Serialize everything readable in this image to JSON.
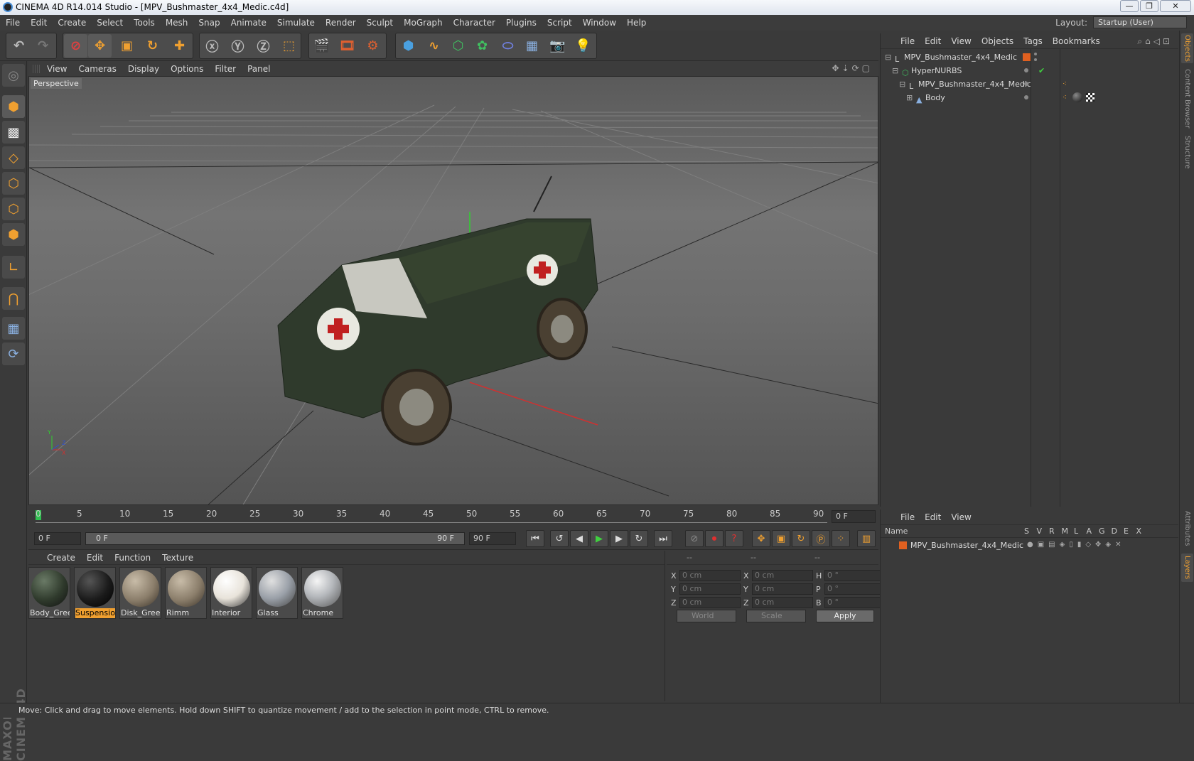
{
  "window": {
    "title": "CINEMA 4D R14.014 Studio - [MPV_Bushmaster_4x4_Medic.c4d]",
    "buttons": {
      "minimize": "—",
      "maximize": "❐",
      "close": "✕"
    }
  },
  "menubar": {
    "items": [
      "File",
      "Edit",
      "Create",
      "Select",
      "Tools",
      "Mesh",
      "Snap",
      "Animate",
      "Simulate",
      "Render",
      "Sculpt",
      "MoGraph",
      "Character",
      "Plugins",
      "Script",
      "Window",
      "Help"
    ],
    "layout_label": "Layout:",
    "layout_value": "Startup (User)"
  },
  "viewport": {
    "menu": [
      "View",
      "Cameras",
      "Display",
      "Options",
      "Filter",
      "Panel"
    ],
    "label": "Perspective",
    "axis_labels": {
      "y": "Y",
      "z": "Z",
      "x": "X"
    }
  },
  "timeline": {
    "ticks": [
      "0",
      "5",
      "10",
      "15",
      "20",
      "25",
      "30",
      "35",
      "40",
      "45",
      "50",
      "55",
      "60",
      "65",
      "70",
      "75",
      "80",
      "85",
      "90"
    ],
    "end_field": "0 F"
  },
  "transport": {
    "current_frame": "0 F",
    "range_start": "0 F",
    "range_end_inner": "90 F",
    "range_end": "90 F"
  },
  "materials": {
    "menu": [
      "Create",
      "Edit",
      "Function",
      "Texture"
    ],
    "items": [
      {
        "name": "Body_Gree",
        "selected": false,
        "color": "#2f3a2c"
      },
      {
        "name": "Suspension",
        "selected": true,
        "color": "#1a1a1a"
      },
      {
        "name": "Disk_Greer",
        "selected": false,
        "color": "#8a7d6a"
      },
      {
        "name": "Rimm",
        "selected": false,
        "color": "#8a7d6a"
      },
      {
        "name": "Interior",
        "selected": false,
        "color": "#e8e3da"
      },
      {
        "name": "Glass",
        "selected": false,
        "color": "#9aa0a8"
      },
      {
        "name": "Chrome",
        "selected": false,
        "color": "#b5b8bc"
      }
    ]
  },
  "coordinates": {
    "headers": [
      "--",
      "--",
      "--"
    ],
    "rows": [
      {
        "a": "X",
        "av": "0 cm",
        "b": "X",
        "bv": "0 cm",
        "c": "H",
        "cv": "0 °"
      },
      {
        "a": "Y",
        "av": "0 cm",
        "b": "Y",
        "bv": "0 cm",
        "c": "P",
        "cv": "0 °"
      },
      {
        "a": "Z",
        "av": "0 cm",
        "b": "Z",
        "bv": "0 cm",
        "c": "B",
        "cv": "0 °"
      }
    ],
    "mode1": "World",
    "mode2": "Scale",
    "apply": "Apply"
  },
  "objects": {
    "menu": [
      "File",
      "Edit",
      "View",
      "Objects",
      "Tags",
      "Bookmarks"
    ],
    "tree": [
      {
        "name": "MPV_Bushmaster_4x4_Medic",
        "type": "null"
      },
      {
        "name": "HyperNURBS",
        "type": "hypernurbs"
      },
      {
        "name": "MPV_Bushmaster_4x4_Medic",
        "type": "null"
      },
      {
        "name": "Body",
        "type": "polygon"
      }
    ]
  },
  "side_tabs": [
    "Objects",
    "Content Browser",
    "Structure",
    "Attributes",
    "Layers"
  ],
  "layers": {
    "menu": [
      "File",
      "Edit",
      "View"
    ],
    "name_header": "Name",
    "columns": [
      "S",
      "V",
      "R",
      "M",
      "L",
      "A",
      "G",
      "D",
      "E",
      "X"
    ],
    "rows": [
      {
        "name": "MPV_Bushmaster_4x4_Medic",
        "color": "#e06020"
      }
    ]
  },
  "branding": "MAXON CINEMA4D",
  "status": "Move: Click and drag to move elements. Hold down SHIFT to quantize movement / add to the selection in point mode, CTRL to remove.",
  "colors": {
    "accent": "#f0a030",
    "bg": "#3a3a3a",
    "panel": "#4a4a4a"
  }
}
